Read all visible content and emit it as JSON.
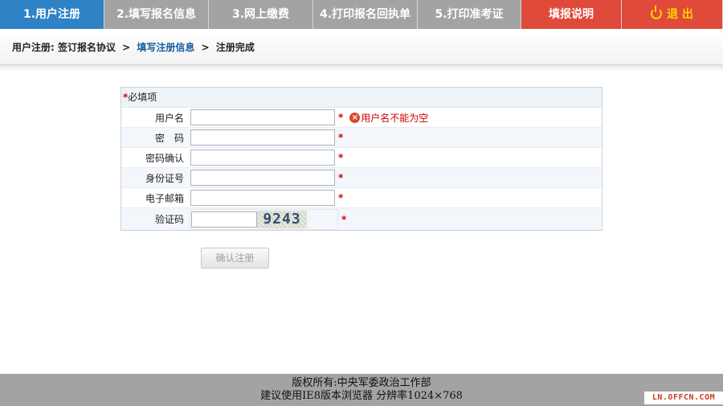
{
  "nav": {
    "tabs": [
      {
        "label": "1.用户注册"
      },
      {
        "label": "2.填写报名信息"
      },
      {
        "label": "3.网上缴费"
      },
      {
        "label": "4.打印报名回执单"
      },
      {
        "label": "5.打印准考证"
      },
      {
        "label": "填报说明"
      },
      {
        "label": "退 出"
      }
    ]
  },
  "breadcrumb": {
    "prefix": "用户注册: 签订报名协议",
    "sep1": ">",
    "current": "填写注册信息",
    "sep2": ">",
    "last": "注册完成"
  },
  "form": {
    "required_star": "*",
    "required_label": "必填项",
    "fields": [
      {
        "label": "用户名",
        "value": "",
        "error": "用户名不能为空"
      },
      {
        "label": "密　码",
        "value": ""
      },
      {
        "label": "密码确认",
        "value": ""
      },
      {
        "label": "身份证号",
        "value": ""
      },
      {
        "label": "电子邮箱",
        "value": ""
      },
      {
        "label": "验证码",
        "value": "",
        "captcha": "9243"
      }
    ],
    "submit_label": "确认注册"
  },
  "footer": {
    "line1": "版权所有:中央军委政治工作部",
    "line2": "建议使用IE8版本浏览器 分辨率1024×768"
  },
  "watermark": "LN.OFFCN.COM",
  "colors": {
    "active_tab": "#2e82c6",
    "inactive_tab": "#a3a3a3",
    "red_tab": "#e04a3a",
    "error_red": "#d00000",
    "link_blue": "#1a5fa0"
  },
  "icons": [
    "power-icon",
    "error-icon"
  ]
}
